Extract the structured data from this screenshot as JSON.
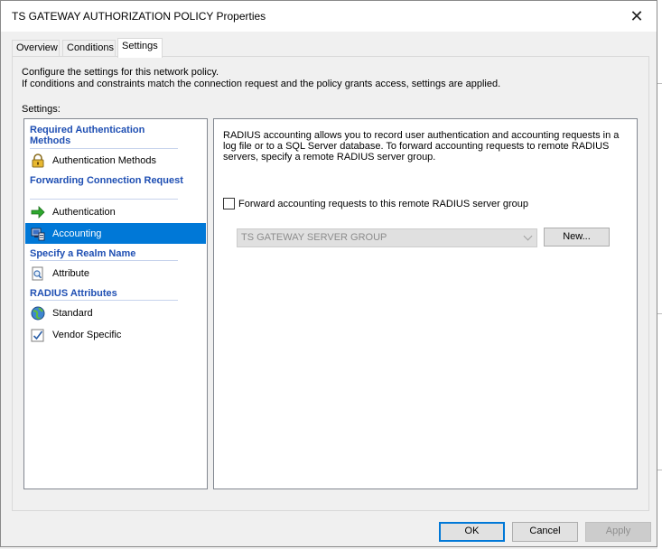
{
  "window": {
    "title": "TS GATEWAY AUTHORIZATION POLICY Properties",
    "close_label": "✕"
  },
  "tabs": [
    {
      "label": "Overview",
      "active": false
    },
    {
      "label": "Conditions",
      "active": false
    },
    {
      "label": "Settings",
      "active": true
    }
  ],
  "panel": {
    "desc_line1": "Configure the settings for this network policy.",
    "desc_line2": "If conditions and constraints match the connection request and the policy grants access, settings are applied.",
    "settings_label": "Settings:"
  },
  "sidebar": {
    "sections": [
      {
        "header": "Required Authentication Methods"
      },
      {
        "header": "Forwarding Connection Request"
      },
      {
        "header": "Specify a Realm Name"
      },
      {
        "header": "RADIUS Attributes"
      }
    ],
    "items": [
      {
        "label": "Authentication Methods",
        "icon": "lock-icon"
      },
      {
        "label": "Authentication",
        "icon": "green-arrow-icon"
      },
      {
        "label": "Accounting",
        "icon": "accounting-computer-icon",
        "selected": true
      },
      {
        "label": "Attribute",
        "icon": "magnifier-document-icon"
      },
      {
        "label": "Standard",
        "icon": "globe-icon"
      },
      {
        "label": "Vendor Specific",
        "icon": "checkmark-document-icon"
      }
    ]
  },
  "accounting": {
    "description": "RADIUS accounting allows you to record user authentication and accounting requests in a log file or to a SQL Server database. To forward accounting requests to remote RADIUS servers, specify a remote RADIUS server group.",
    "checkbox_label": "Forward accounting requests to this remote RADIUS server group",
    "checkbox_checked": false,
    "server_group_value": "TS GATEWAY SERVER GROUP",
    "new_button": "New..."
  },
  "footer": {
    "ok": "OK",
    "cancel": "Cancel",
    "apply": "Apply"
  },
  "colors": {
    "accent": "#0078d7",
    "section_header": "#1f4fb3"
  }
}
